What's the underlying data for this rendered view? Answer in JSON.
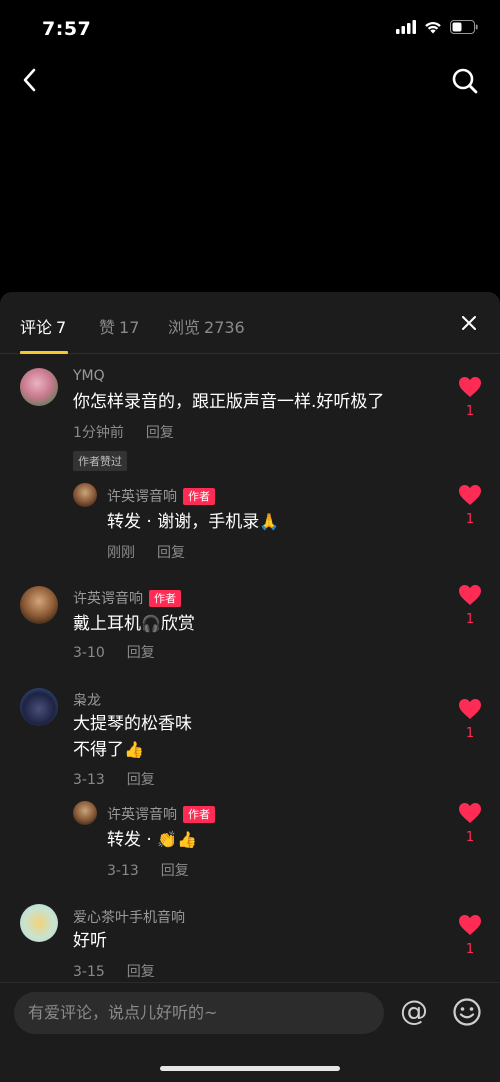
{
  "status_bar": {
    "time": "7:57"
  },
  "tabs": [
    {
      "label": "评论",
      "count": "7"
    },
    {
      "label": "赞",
      "count": "17"
    },
    {
      "label": "浏览",
      "count": "2736"
    }
  ],
  "comments": [
    {
      "user": "YMQ",
      "text": "你怎样录音的，跟正版声音一样.好听极了",
      "time": "1分钟前",
      "reply": "回复",
      "liked_tag": "作者赞过",
      "likes": "1"
    },
    {
      "user": "许英谔音响",
      "badge": "作者",
      "text": "转发 · 谢谢，手机录",
      "text_emoji": "🙏",
      "time": "刚刚",
      "reply": "回复",
      "likes": "1"
    },
    {
      "user": "许英谔音响",
      "badge": "作者",
      "text": "戴上耳机",
      "text_emoji": "🎧",
      "text_after": "欣赏",
      "time": "3-10",
      "reply": "回复",
      "likes": "1"
    },
    {
      "user": "枭龙",
      "text_line1": "大提琴的松香味",
      "text_line2": "不得了",
      "text_emoji": "👍",
      "time": "3-13",
      "reply": "回复",
      "likes": "1"
    },
    {
      "user": "许英谔音响",
      "badge": "作者",
      "text": "转发 · ",
      "text_emoji": "👏👍",
      "time": "3-13",
      "reply": "回复",
      "likes": "1"
    },
    {
      "user": "爱心茶叶手机音响",
      "text": "好听",
      "time": "3-15",
      "reply": "回复",
      "likes": "1"
    }
  ],
  "input": {
    "placeholder": "有爱评论，说点儿好听的~",
    "at_symbol": "@"
  },
  "colors": {
    "accent": "#f6c82c",
    "like": "#fe2c55",
    "sheet_bg": "#1c1c1c"
  }
}
